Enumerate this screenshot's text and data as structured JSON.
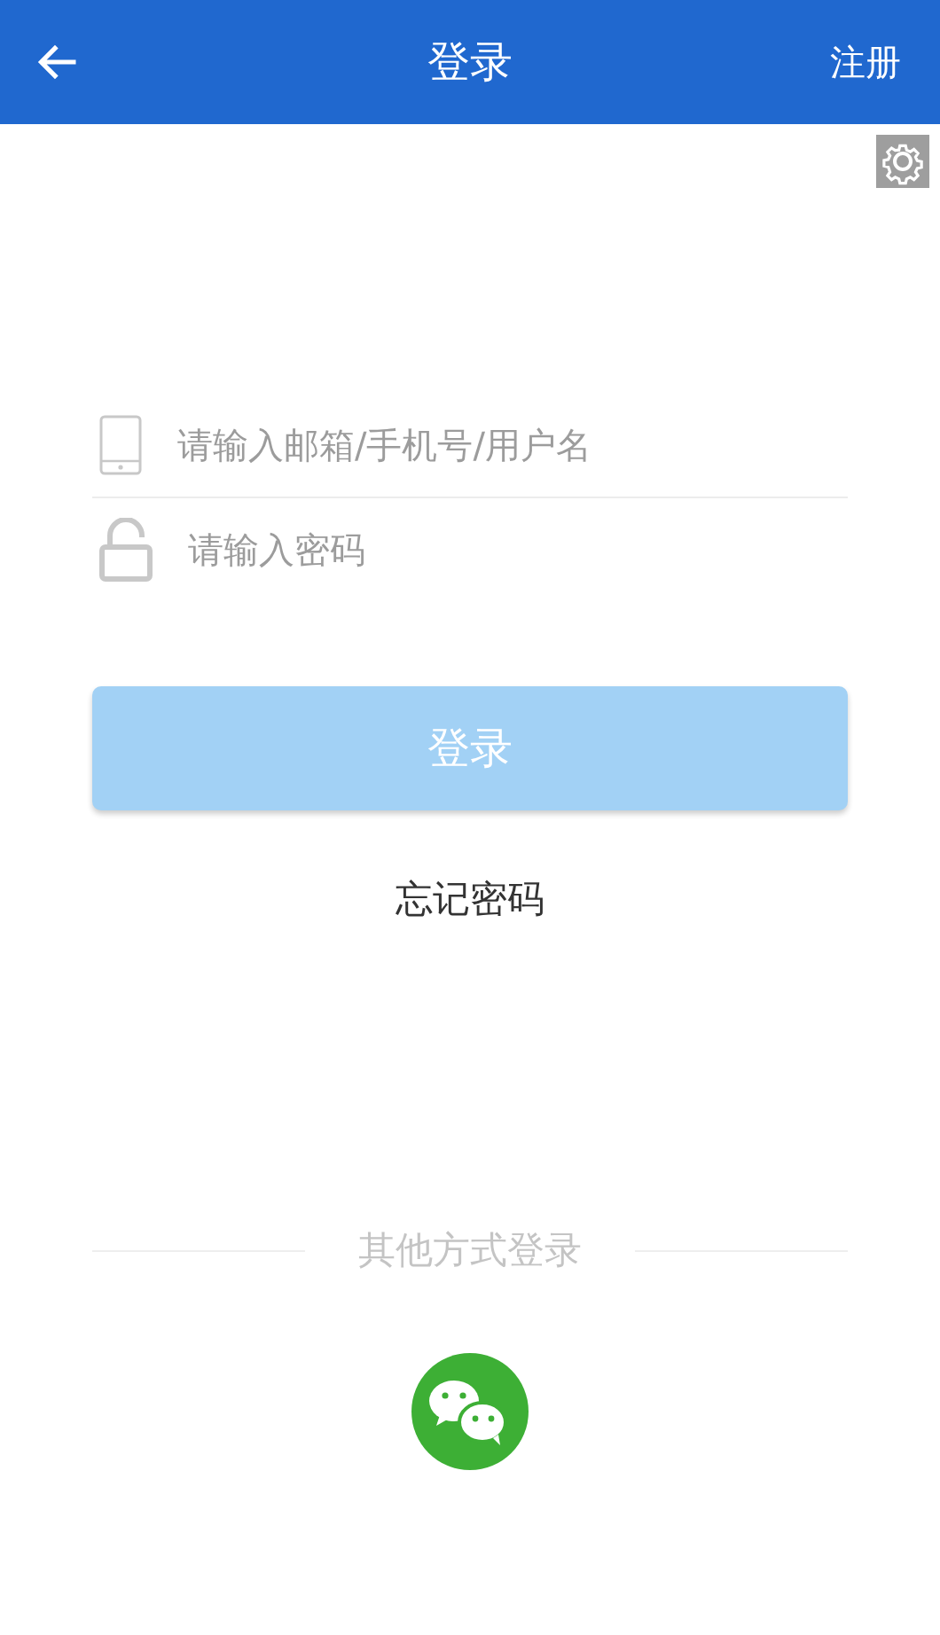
{
  "header": {
    "title": "登录",
    "action": "注册"
  },
  "fields": [
    {
      "kind": "account",
      "placeholder": "请输入邮箱/手机号/用户名"
    },
    {
      "kind": "password",
      "placeholder": "请输入密码"
    }
  ],
  "login_button": {
    "label": "登录",
    "disabled": true
  },
  "forgot_link": "忘记密码",
  "other_login": {
    "label": "其他方式登录"
  }
}
